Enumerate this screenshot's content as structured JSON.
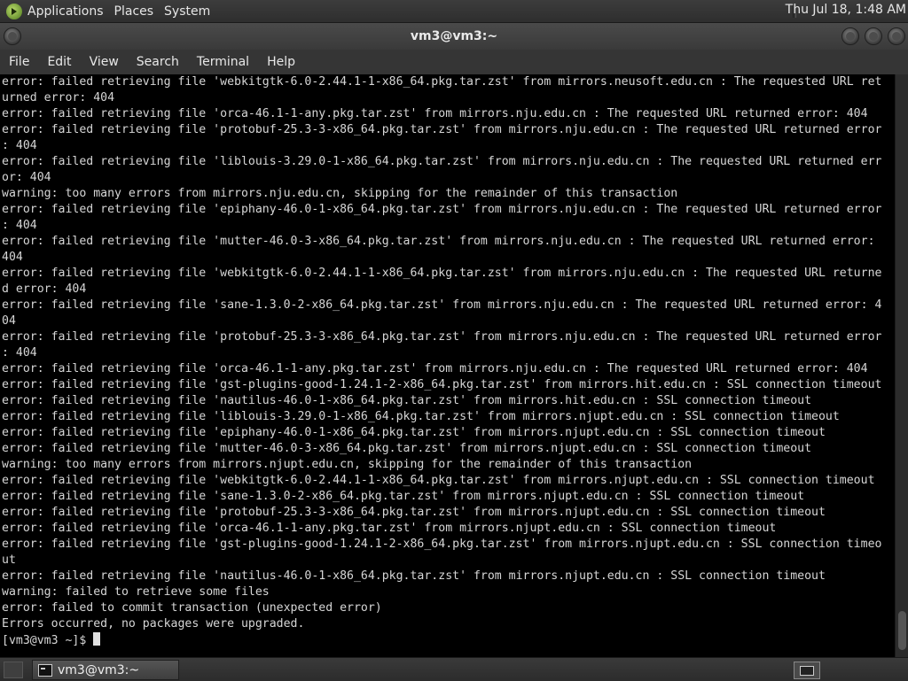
{
  "top_panel": {
    "menus": [
      "Applications",
      "Places",
      "System"
    ],
    "clock": "Thu Jul 18,  1:48 AM"
  },
  "window": {
    "title": "vm3@vm3:~",
    "menu": [
      "File",
      "Edit",
      "View",
      "Search",
      "Terminal",
      "Help"
    ]
  },
  "terminal": {
    "lines": [
      "error: failed retrieving file 'webkitgtk-6.0-2.44.1-1-x86_64.pkg.tar.zst' from mirrors.neusoft.edu.cn : The requested URL ret",
      "urned error: 404",
      "error: failed retrieving file 'orca-46.1-1-any.pkg.tar.zst' from mirrors.nju.edu.cn : The requested URL returned error: 404",
      "error: failed retrieving file 'protobuf-25.3-3-x86_64.pkg.tar.zst' from mirrors.nju.edu.cn : The requested URL returned error",
      ": 404",
      "error: failed retrieving file 'liblouis-3.29.0-1-x86_64.pkg.tar.zst' from mirrors.nju.edu.cn : The requested URL returned err",
      "or: 404",
      "warning: too many errors from mirrors.nju.edu.cn, skipping for the remainder of this transaction",
      "error: failed retrieving file 'epiphany-46.0-1-x86_64.pkg.tar.zst' from mirrors.nju.edu.cn : The requested URL returned error",
      ": 404",
      "error: failed retrieving file 'mutter-46.0-3-x86_64.pkg.tar.zst' from mirrors.nju.edu.cn : The requested URL returned error:",
      "404",
      "error: failed retrieving file 'webkitgtk-6.0-2.44.1-1-x86_64.pkg.tar.zst' from mirrors.nju.edu.cn : The requested URL returne",
      "d error: 404",
      "error: failed retrieving file 'sane-1.3.0-2-x86_64.pkg.tar.zst' from mirrors.nju.edu.cn : The requested URL returned error: 4",
      "04",
      "error: failed retrieving file 'protobuf-25.3-3-x86_64.pkg.tar.zst' from mirrors.nju.edu.cn : The requested URL returned error",
      ": 404",
      "error: failed retrieving file 'orca-46.1-1-any.pkg.tar.zst' from mirrors.nju.edu.cn : The requested URL returned error: 404",
      "error: failed retrieving file 'gst-plugins-good-1.24.1-2-x86_64.pkg.tar.zst' from mirrors.hit.edu.cn : SSL connection timeout",
      "error: failed retrieving file 'nautilus-46.0-1-x86_64.pkg.tar.zst' from mirrors.hit.edu.cn : SSL connection timeout",
      "error: failed retrieving file 'liblouis-3.29.0-1-x86_64.pkg.tar.zst' from mirrors.njupt.edu.cn : SSL connection timeout",
      "error: failed retrieving file 'epiphany-46.0-1-x86_64.pkg.tar.zst' from mirrors.njupt.edu.cn : SSL connection timeout",
      "error: failed retrieving file 'mutter-46.0-3-x86_64.pkg.tar.zst' from mirrors.njupt.edu.cn : SSL connection timeout",
      "warning: too many errors from mirrors.njupt.edu.cn, skipping for the remainder of this transaction",
      "error: failed retrieving file 'webkitgtk-6.0-2.44.1-1-x86_64.pkg.tar.zst' from mirrors.njupt.edu.cn : SSL connection timeout",
      "error: failed retrieving file 'sane-1.3.0-2-x86_64.pkg.tar.zst' from mirrors.njupt.edu.cn : SSL connection timeout",
      "error: failed retrieving file 'protobuf-25.3-3-x86_64.pkg.tar.zst' from mirrors.njupt.edu.cn : SSL connection timeout",
      "error: failed retrieving file 'orca-46.1-1-any.pkg.tar.zst' from mirrors.njupt.edu.cn : SSL connection timeout",
      "error: failed retrieving file 'gst-plugins-good-1.24.1-2-x86_64.pkg.tar.zst' from mirrors.njupt.edu.cn : SSL connection timeo",
      "ut",
      "error: failed retrieving file 'nautilus-46.0-1-x86_64.pkg.tar.zst' from mirrors.njupt.edu.cn : SSL connection timeout",
      "warning: failed to retrieve some files",
      "error: failed to commit transaction (unexpected error)",
      "Errors occurred, no packages were upgraded."
    ],
    "prompt": "[vm3@vm3 ~]$ "
  },
  "taskbar": {
    "task_label": "vm3@vm3:~"
  },
  "colors": {
    "terminal_bg": "#000000",
    "terminal_fg": "#d6d6d6",
    "panel_bg": "#333333"
  }
}
